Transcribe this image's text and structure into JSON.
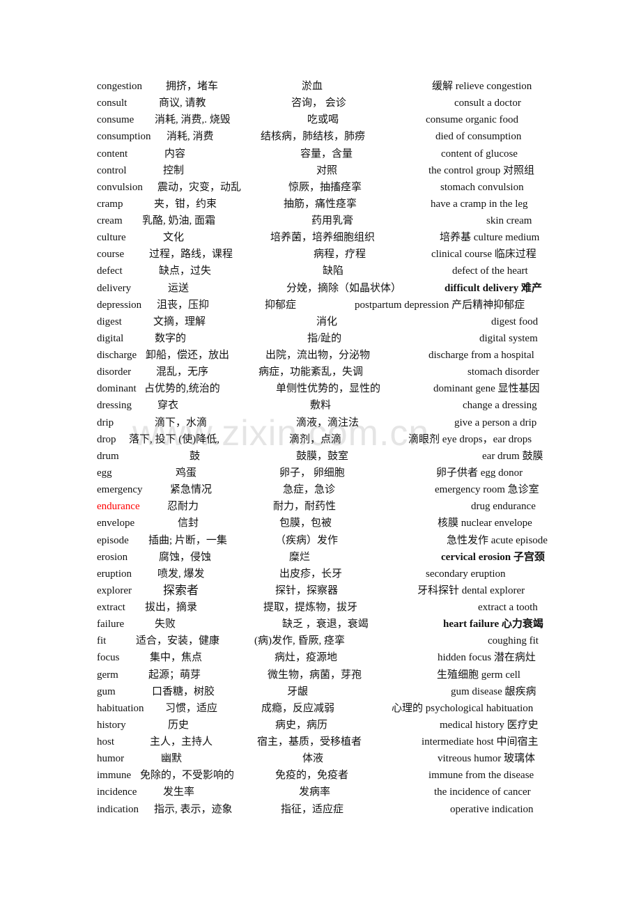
{
  "watermark": "www.zixin.com.cn",
  "rows": [
    {
      "word": "congestion",
      "general": "拥挤，堵车",
      "medical": "淤血",
      "example": "缓解  relieve congestion"
    },
    {
      "word": "consult",
      "general": "商议, 请教",
      "medical": "咨询，  会诊",
      "example": "consult a doctor"
    },
    {
      "word": "consume",
      "general": "消耗, 消费,. 烧毁",
      "medical": "吃或喝",
      "example": "consume organic food"
    },
    {
      "word": "consumption",
      "general": "消耗, 消费",
      "medical": "结核病，肺结核，肺痨",
      "example": "died of consumption"
    },
    {
      "word": "content",
      "general": "内容",
      "medical": "容量，含量",
      "example": "content of glucose"
    },
    {
      "word": "control",
      "general": "控制",
      "medical": "对照",
      "example": "the control group 对照组"
    },
    {
      "word": "convulsion",
      "general": "震动，灾变，动乱",
      "medical": "惊厥，抽搐痉挛",
      "example": "stomach convulsion"
    },
    {
      "word": "cramp",
      "general": "夹，钳，约束",
      "medical": "抽筋，痛性痉挛",
      "example": "have a cramp in the leg"
    },
    {
      "word": "cream",
      "general": "乳酪, 奶油, 面霜",
      "medical": "药用乳膏",
      "example": "skin cream"
    },
    {
      "word": "culture",
      "general": "文化",
      "medical": "培养菌，培养细胞组织",
      "example": "培养基 culture medium"
    },
    {
      "word": "course",
      "general": "过程，路线，课程",
      "medical": "病程，疗程",
      "example": "clinical course 临床过程"
    },
    {
      "word": "defect",
      "general": "缺点，过失",
      "medical": "缺陷",
      "example": "defect of the heart"
    },
    {
      "word": "delivery",
      "general": "运送",
      "medical": "分娩，摘除（如晶状体）",
      "example": "difficult delivery 难产"
    },
    {
      "word": "depression",
      "general": "沮丧，压抑",
      "medical": "抑郁症",
      "example": "postpartum depression 产后精神抑郁症"
    },
    {
      "word": "digest",
      "general": "文摘，理解",
      "medical": "消化",
      "example": "digest food"
    },
    {
      "word": "digital",
      "general": "数字的",
      "medical": "指/趾的",
      "example": "digital system"
    },
    {
      "word": "discharge",
      "general": "卸船，偿还，放出",
      "medical": "出院，流出物，分泌物",
      "example": "discharge from a hospital"
    },
    {
      "word": "disorder",
      "general": "混乱，无序",
      "medical": "病症，功能紊乱，失调",
      "example": "stomach disorder"
    },
    {
      "word": "dominant",
      "general": "占优势的,统治的",
      "medical": "单侧性优势的，显性的",
      "example": "dominant gene 显性基因"
    },
    {
      "word": "dressing",
      "general": "穿衣",
      "medical": "敷料",
      "example": "change a dressing"
    },
    {
      "word": "drip",
      "general": "滴下，水滴",
      "medical": "滴液，滴注法",
      "example": "give a person a drip"
    },
    {
      "word": "drop",
      "general": "落下, 投下  (使)降低,",
      "medical": "滴剂，点滴",
      "example": "滴眼剂      eye drops，ear drops"
    },
    {
      "word": "drum",
      "general": "鼓",
      "medical": "鼓膜，鼓室",
      "example": "ear drum 鼓膜"
    },
    {
      "word": "egg",
      "general": "鸡蛋",
      "medical": "卵子，  卵细胞",
      "example": "卵子供者      egg donor"
    },
    {
      "word": "emergency",
      "general": "紧急情况",
      "medical": "急症，急诊",
      "example": "emergency room 急诊室"
    },
    {
      "word": "endurance",
      "general": "忍耐力",
      "medical": "耐力，耐药性",
      "example": "drug endurance"
    },
    {
      "word": "envelope",
      "general": "信封",
      "medical": "包膜，包被",
      "example": "核膜    nuclear envelope"
    },
    {
      "word": "episode",
      "general": "插曲; 片断，一集",
      "medical": "（疾病）发作",
      "example": "急性发作  acute episode"
    },
    {
      "word": "erosion",
      "general": "腐蚀，侵蚀",
      "medical": "糜烂",
      "example": "cervical erosion 子宫颈"
    },
    {
      "word": "eruption",
      "general": "喷发, 爆发",
      "medical": "出皮疹，长牙",
      "example": "secondary eruption"
    },
    {
      "word": "explorer",
      "general": "探索者",
      "medical": "探针，探察器",
      "example": "牙科探针  dental explorer"
    },
    {
      "word": "extract",
      "general": "拔出，摘录",
      "medical": "提取，提炼物，拔牙",
      "example": "extract a tooth"
    },
    {
      "word": "failure",
      "general": "失败",
      "medical": "缺乏 ，衰退，衰竭",
      "example": "heart failure 心力衰竭"
    },
    {
      "word": "fit",
      "general": "适合，安装，健康",
      "medical": "(病)发作, 昏厥, 痉挛",
      "example": "coughing fit"
    },
    {
      "word": "focus",
      "general": "集中，焦点",
      "medical": "病灶，疫源地",
      "example": "hidden focus 潜在病灶"
    },
    {
      "word": "germ",
      "general": "起源；萌芽",
      "medical": "微生物，病菌，芽孢",
      "example": "生殖细胞    germ cell"
    },
    {
      "word": "gum",
      "general": "口香糖，树胶",
      "medical": "牙龈",
      "example": "gum disease 龈疾病"
    },
    {
      "word": "habituation",
      "general": "习惯，适应",
      "medical": "成瘾，反应减弱",
      "example": "心理的  psychological habituation"
    },
    {
      "word": "history",
      "general": "历史",
      "medical": "病史，病历",
      "example": "medical history 医疗史"
    },
    {
      "word": "host",
      "general": "主人，主持人",
      "medical": "宿主，基质，受移植者",
      "example": "intermediate host 中间宿主"
    },
    {
      "word": "humor",
      "general": "幽默",
      "medical": "体液",
      "example": "vitreous humor 玻璃体"
    },
    {
      "word": "immune",
      "general": "免除的，不受影响的",
      "medical": "免疫的，免疫者",
      "example": "immune from the disease"
    },
    {
      "word": "incidence",
      "general": "发生率",
      "medical": "发病率",
      "example": "the incidence of cancer"
    },
    {
      "word": "indication",
      "general": "指示, 表示，迹象",
      "medical": "指征，适应症",
      "example": "operative indication"
    }
  ]
}
